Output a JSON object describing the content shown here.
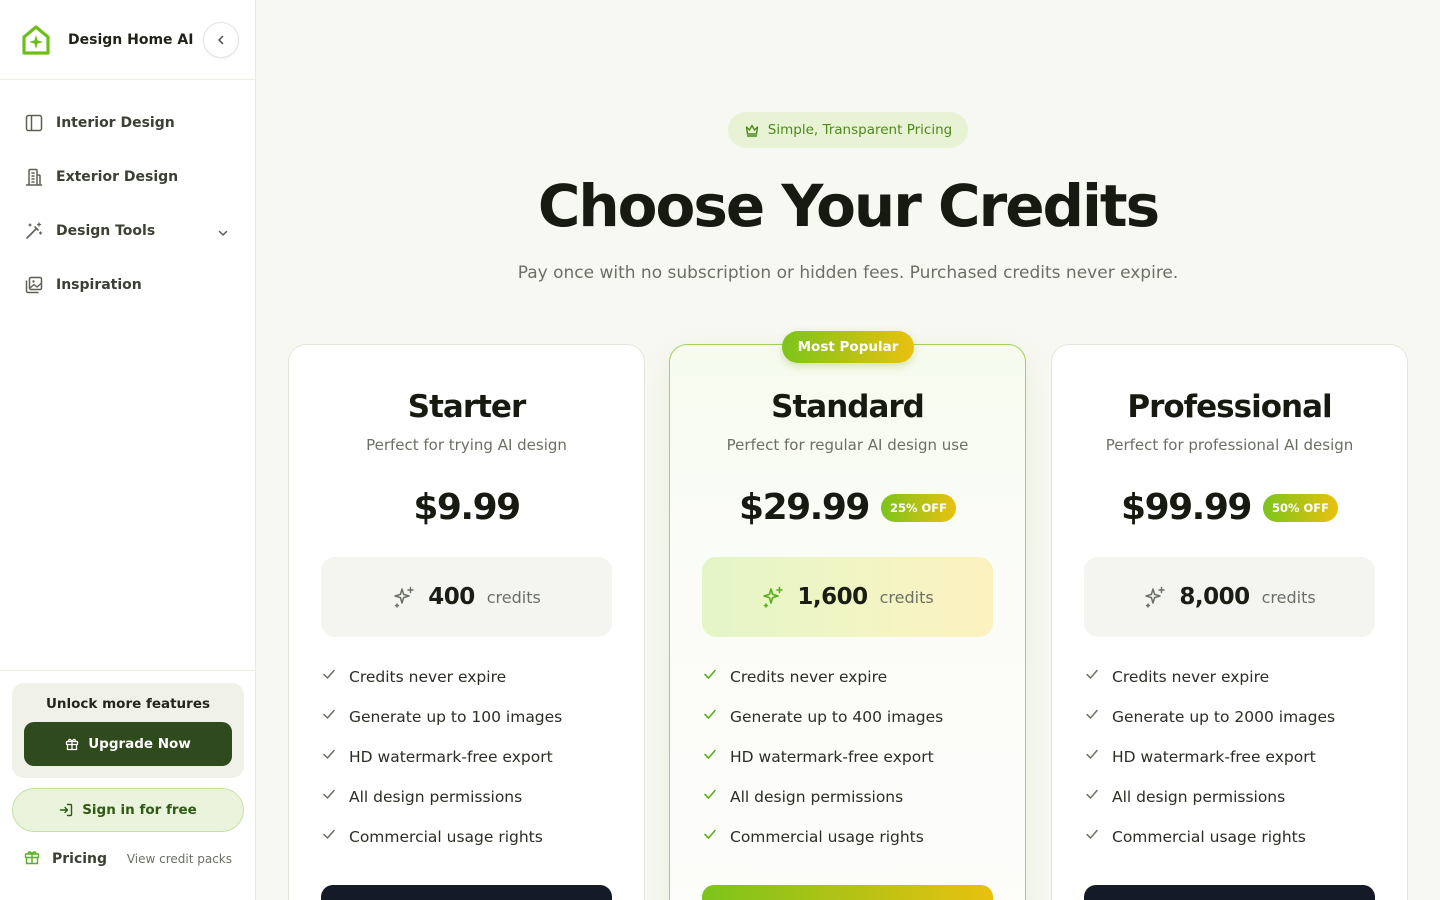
{
  "app": {
    "name": "Design Home AI"
  },
  "colors": {
    "accent_green": "#7cc41b",
    "accent_yellow": "#e9c10f",
    "dark_green": "#2f4a1c",
    "dark_navy": "#141a26"
  },
  "sidebar": {
    "items": [
      {
        "label": "Interior Design",
        "icon": "sidebar-panel-icon"
      },
      {
        "label": "Exterior Design",
        "icon": "building-icon"
      },
      {
        "label": "Design Tools",
        "icon": "magic-wand-icon",
        "expandable": true
      },
      {
        "label": "Inspiration",
        "icon": "image-gallery-icon"
      }
    ],
    "unlock": {
      "title": "Unlock more features",
      "button": "Upgrade Now"
    },
    "signin": "Sign in for free",
    "pricing": {
      "label": "Pricing",
      "sub": "View credit packs"
    }
  },
  "header": {
    "pill": "Simple, Transparent Pricing",
    "title": "Choose Your Credits",
    "subtitle": "Pay once with no subscription or hidden fees. Purchased credits never expire."
  },
  "plans": [
    {
      "name": "Starter",
      "description": "Perfect for trying AI design",
      "price": "$9.99",
      "discount": "",
      "credits": "400",
      "credits_unit": "credits",
      "features": [
        "Credits never expire",
        "Generate up to 100 images",
        "HD watermark-free export",
        "All design permissions",
        "Commercial usage rights"
      ]
    },
    {
      "name": "Standard",
      "badge": "Most Popular",
      "description": "Perfect for regular AI design use",
      "price": "$29.99",
      "discount": "25% OFF",
      "credits": "1,600",
      "credits_unit": "credits",
      "features": [
        "Credits never expire",
        "Generate up to 400 images",
        "HD watermark-free export",
        "All design permissions",
        "Commercial usage rights"
      ]
    },
    {
      "name": "Professional",
      "description": "Perfect for professional AI design",
      "price": "$99.99",
      "discount": "50% OFF",
      "credits": "8,000",
      "credits_unit": "credits",
      "features": [
        "Credits never expire",
        "Generate up to 2000 images",
        "HD watermark-free export",
        "All design permissions",
        "Commercial usage rights"
      ]
    }
  ]
}
